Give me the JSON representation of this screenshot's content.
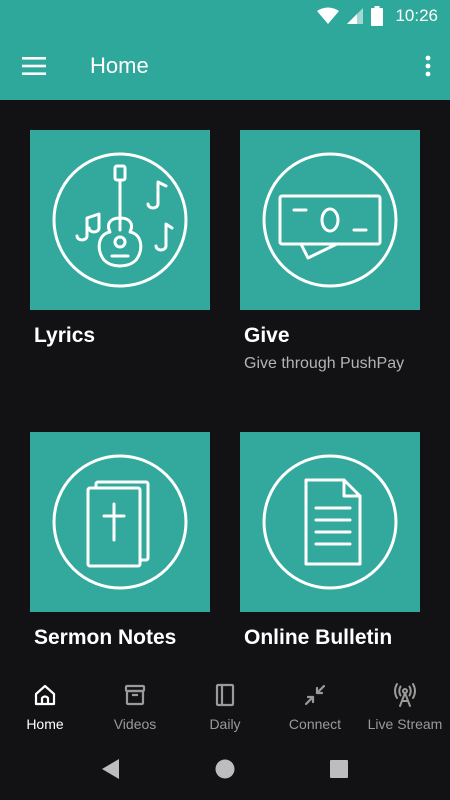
{
  "status_bar": {
    "time": "10:26"
  },
  "app_bar": {
    "title": "Home",
    "menu_icon": "hamburger-menu-icon",
    "overflow_icon": "more-vert-icon"
  },
  "cards": [
    {
      "title": "Lyrics",
      "subtitle": "",
      "icon": "music-guitar-icon"
    },
    {
      "title": "Give",
      "subtitle": "Give through PushPay",
      "icon": "money-bill-icon"
    },
    {
      "title": "Sermon Notes",
      "subtitle": "",
      "icon": "bible-icon"
    },
    {
      "title": "Online Bulletin",
      "subtitle": "",
      "icon": "document-icon"
    }
  ],
  "bottom_nav": [
    {
      "label": "Home",
      "icon": "home-icon",
      "active": true
    },
    {
      "label": "Videos",
      "icon": "archive-box-icon",
      "active": false
    },
    {
      "label": "Daily",
      "icon": "book-icon",
      "active": false
    },
    {
      "label": "Connect",
      "icon": "connect-arrows-icon",
      "active": false
    },
    {
      "label": "Live Stream",
      "icon": "broadcast-tower-icon",
      "active": false
    }
  ],
  "colors": {
    "accent": "#2fa89c",
    "tile": "#32a99c",
    "background": "#121214",
    "inactive": "#9a9a9a"
  }
}
